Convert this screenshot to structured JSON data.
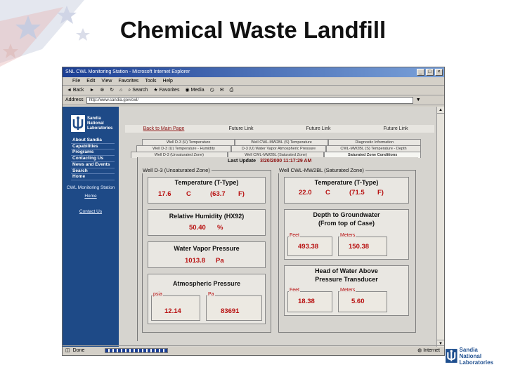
{
  "slide": {
    "title": "Chemical Waste Landfill"
  },
  "browser": {
    "window_title": "SNL CWL Monitoring Station - Microsoft Internet Explorer",
    "menu": [
      "File",
      "Edit",
      "View",
      "Favorites",
      "Tools",
      "Help"
    ],
    "toolbar": [
      "Back",
      "Search",
      "Favorites",
      "Media"
    ],
    "address_label": "Address",
    "address_value": "http://www.sandia.gov/cwl/",
    "status_text": "Done",
    "status_zone": "Internet"
  },
  "sidebar": {
    "logo": [
      "Sandia",
      "National",
      "Laboratories"
    ],
    "menu": [
      "About Sandia",
      "Capabilities",
      "Programs",
      "Contacting Us",
      "News and Events",
      "Search",
      "Home"
    ],
    "station_label": "CWL Monitoring Station",
    "home_link": "Home",
    "contact_link": "Contact Us"
  },
  "toplinks": [
    "Back to Main Page",
    "Future Link",
    "Future Link",
    "Future Link"
  ],
  "tabs": {
    "row1": [
      "Well D-3 (U) Temperature",
      "Well CWL-MW2BL (S) Temperature",
      "Diagnostic Information"
    ],
    "row2": [
      "Well D-3 (U) Temperature - Humidity",
      "D-3 (U) Water Vapor Atmospheric Pressure",
      "CWL-MW2BL (S) Temperature - Depth"
    ],
    "row3": [
      "Well D-3 (Unsaturated Zone)",
      "Well CWL-MW2BL (Saturated Zone)",
      "Saturated Zone Conditions"
    ]
  },
  "last_update": {
    "label": "Last Update",
    "value": "3/20/2000 11:17:29 AM"
  },
  "left_group": {
    "label": "Well D-3 (Unsaturated Zone)",
    "temperature": {
      "title": "Temperature (T-Type)",
      "c": "17.6",
      "c_unit": "C",
      "f": "(63.7",
      "f_unit": "F)"
    },
    "humidity": {
      "title": "Relative Humidity (HX92)",
      "value": "50.40",
      "unit": "%"
    },
    "vapor": {
      "title": "Water Vapor Pressure",
      "value": "1013.8",
      "unit": "Pa"
    },
    "atmospheric": {
      "title": "Atmospheric Pressure",
      "psia_label": "psia",
      "psia": "12.14",
      "pa_label": "Pa",
      "pa": "83691"
    }
  },
  "right_group": {
    "label": "Well CWL-MW2BL (Saturated Zone)",
    "temperature": {
      "title": "Temperature (T-Type)",
      "c": "22.0",
      "c_unit": "C",
      "f": "(71.5",
      "f_unit": "F)"
    },
    "depth": {
      "title1": "Depth to Groundwater",
      "title2": "(From top of Case)",
      "feet_label": "Feet",
      "feet": "493.38",
      "meters_label": "Meters",
      "meters": "150.38"
    },
    "head": {
      "title1": "Head of Water Above",
      "title2": "Pressure Transducer",
      "feet_label": "Feet",
      "feet": "18.38",
      "meters_label": "Meters",
      "meters": "5.60"
    }
  },
  "colors": {
    "sidebar": "#1e4a87",
    "value_red": "#b81010",
    "panel_bg": "#d6d4cf"
  }
}
